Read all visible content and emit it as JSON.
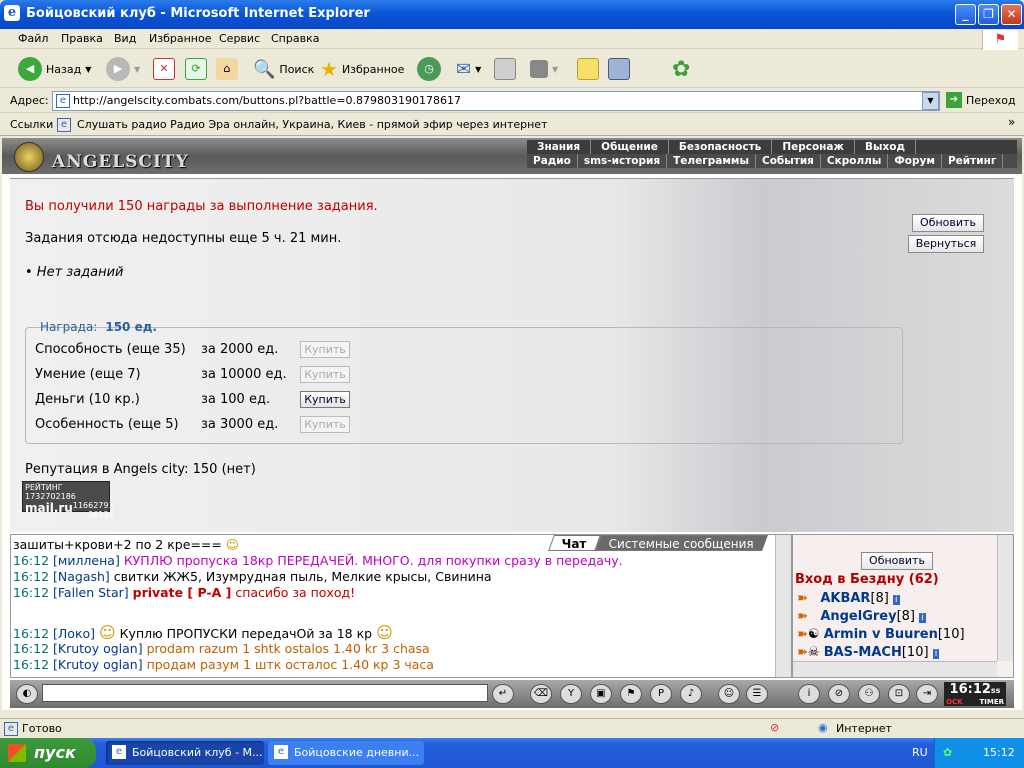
{
  "window": {
    "title": "Бойцовский клуб - Microsoft Internet Explorer"
  },
  "menu": [
    "Файл",
    "Правка",
    "Вид",
    "Избранное",
    "Сервис",
    "Справка"
  ],
  "toolbar": {
    "back": "Назад",
    "search": "Поиск",
    "favorites": "Избранное"
  },
  "address": {
    "label": "Адрес:",
    "url": "http://angelscity.combats.com/buttons.pl?battle=0.879803190178617",
    "go": "Переход"
  },
  "links": {
    "label": "Ссылки",
    "item": "Слушать радио Радио Эра онлайн, Украина, Киев - прямой эфир через интернет"
  },
  "game": {
    "logo": "ANGELSCITY",
    "nav_top": [
      "Знания",
      "Общение",
      "Безопасность",
      "Персонаж",
      "Выход"
    ],
    "nav_bottom": [
      "Радио",
      "sms-история",
      "Телеграммы",
      "События",
      "Скроллы",
      "Форум",
      "Рейтинг"
    ],
    "message_reward": "Вы получили 150 награды за выполнение задания.",
    "message_wait": "Задания отсюда недоступны еще 5 ч. 21 мин.",
    "no_tasks": "• Нет заданий",
    "refresh_btn": "Обновить",
    "back_btn": "Вернуться",
    "reward_label": "Награда:",
    "reward_value": "150 ед.",
    "rows": [
      {
        "name": "Способность (еще 35)",
        "price": "за 2000 ед.",
        "buy": "Купить",
        "enabled": false
      },
      {
        "name": "Умение (еще 7)",
        "price": "за 10000 ед.",
        "buy": "Купить",
        "enabled": false
      },
      {
        "name": "Деньги (10 кр.)",
        "price": "за 100 ед.",
        "buy": "Купить",
        "enabled": true
      },
      {
        "name": "Особенность (еще 5)",
        "price": "за 3000 ед.",
        "buy": "Купить",
        "enabled": false
      }
    ],
    "reputation": "Репутация в Angels city: 150 (нет)",
    "counter": {
      "label": "РЕЙТИНГ",
      "n1": "1732702186",
      "brand": "mail.ru",
      "n2": "11662793",
      "n3": "36134"
    }
  },
  "chat": {
    "tabs": [
      "Чат",
      "Системные сообщения"
    ],
    "lines": [
      {
        "text": "зашиты+крови+2 по 2 кре===",
        "time": "",
        "nick": "",
        "color": "#000000"
      },
      {
        "time": "16:12",
        "nick": "[миллена]",
        "text": "КУПЛЮ пропуска 18кр ПЕРЕДАЧЕЙ. МНОГО. для покупки сразу в передачу.",
        "color": "#c000c0"
      },
      {
        "time": "16:12",
        "nick": "[Nagash]",
        "text": "свитки ЖЖ5, Изумрудная пыль, Мелкие крысы, Свинина",
        "color": "#000000"
      },
      {
        "time": "16:12",
        "nick": "[Fallen Star]",
        "text": "спасибо за поход!",
        "private": "private [ P-A ]",
        "color": "#c00000"
      },
      {
        "time": "16:12",
        "nick": "[Локо]",
        "text": "Куплю ПРОПУСКИ передачОй за 18 кр",
        "color": "#000000"
      },
      {
        "time": "16:12",
        "nick": "[Krutoy oglan]",
        "text": "prodam razum 1 shtk ostalos 1.40 kr 3 chasa",
        "color": "#c06000"
      },
      {
        "time": "16:12",
        "nick": "[Krutoy oglan]",
        "text": "продам разум 1 штк осталос 1.40 кр 3 часа",
        "color": "#c06000"
      }
    ]
  },
  "who": {
    "refresh": "Обновить",
    "title": "Вход в Бездну (62)",
    "players": [
      {
        "name": "AKBAR",
        "level": "[8]"
      },
      {
        "name": "AngelGrey",
        "level": "[8]"
      },
      {
        "name": "Armin v Buuren",
        "level": "[10]"
      },
      {
        "name": "BAS-MACH",
        "level": "[10]"
      }
    ]
  },
  "timer": {
    "time": "16:12",
    "ss": "ss",
    "label": "TIMER",
    "ock": "OCK"
  },
  "status": {
    "ready": "Готово",
    "zone": "Интернет"
  },
  "taskbar": {
    "start": "пуск",
    "tasks": [
      "Бойцовский клуб - М...",
      "Бойцовские дневни..."
    ],
    "lang": "RU",
    "clock": "15:12"
  }
}
